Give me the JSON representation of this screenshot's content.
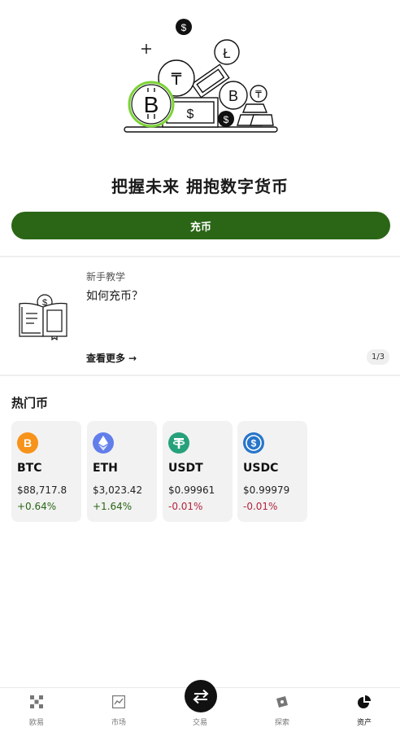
{
  "hero": {
    "headline": "把握未来 拥抱数字货币",
    "deposit_label": "充币"
  },
  "tutorial": {
    "label": "新手教学",
    "title": "如何充币？",
    "more_label": "查看更多",
    "pager": "1/3"
  },
  "hot": {
    "title": "热门币",
    "coins": [
      {
        "symbol": "BTC",
        "price": "$88,717.8",
        "change": "+0.64%",
        "color": "#f7931a",
        "icon": "bitcoin-icon"
      },
      {
        "symbol": "ETH",
        "price": "$3,023.42",
        "change": "+1.64%",
        "color": "#627eea",
        "icon": "ethereum-icon"
      },
      {
        "symbol": "USDT",
        "price": "$0.99961",
        "change": "-0.01%",
        "color": "#26a17b",
        "icon": "tether-icon"
      },
      {
        "symbol": "USDC",
        "price": "$0.99979",
        "change": "-0.01%",
        "color": "#2775ca",
        "icon": "usdc-icon"
      }
    ]
  },
  "tabs": [
    {
      "label": "欧易",
      "icon": "okx-logo-icon"
    },
    {
      "label": "市场",
      "icon": "chart-icon"
    },
    {
      "label": "交易",
      "icon": "swap-icon"
    },
    {
      "label": "探索",
      "icon": "compass-icon"
    },
    {
      "label": "资产",
      "icon": "pie-chart-icon",
      "active": true
    }
  ],
  "colors": {
    "accent": "#2a6616",
    "up": "#2a6616",
    "down": "#b3243e"
  }
}
